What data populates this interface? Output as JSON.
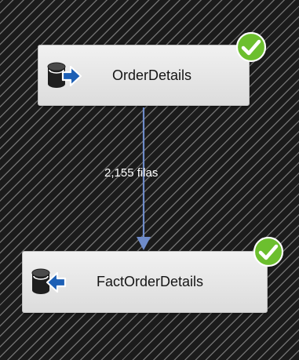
{
  "flow": {
    "source": {
      "label": "OrderDetails",
      "icon": "database-source-arrow-icon",
      "status": "success-check-icon"
    },
    "connector": {
      "row_count": "2,155 filas"
    },
    "destination": {
      "label": "FactOrderDetails",
      "icon": "database-destination-arrow-icon",
      "status": "success-check-icon"
    }
  },
  "colors": {
    "background": "#1b1b1b",
    "hatch": "#6d6d6d",
    "node_fill": "#e6e6e6",
    "success_green": "#6cbf2e",
    "arrow_blue": "#1c5fb5",
    "connector_line": "#6e8bc9"
  }
}
